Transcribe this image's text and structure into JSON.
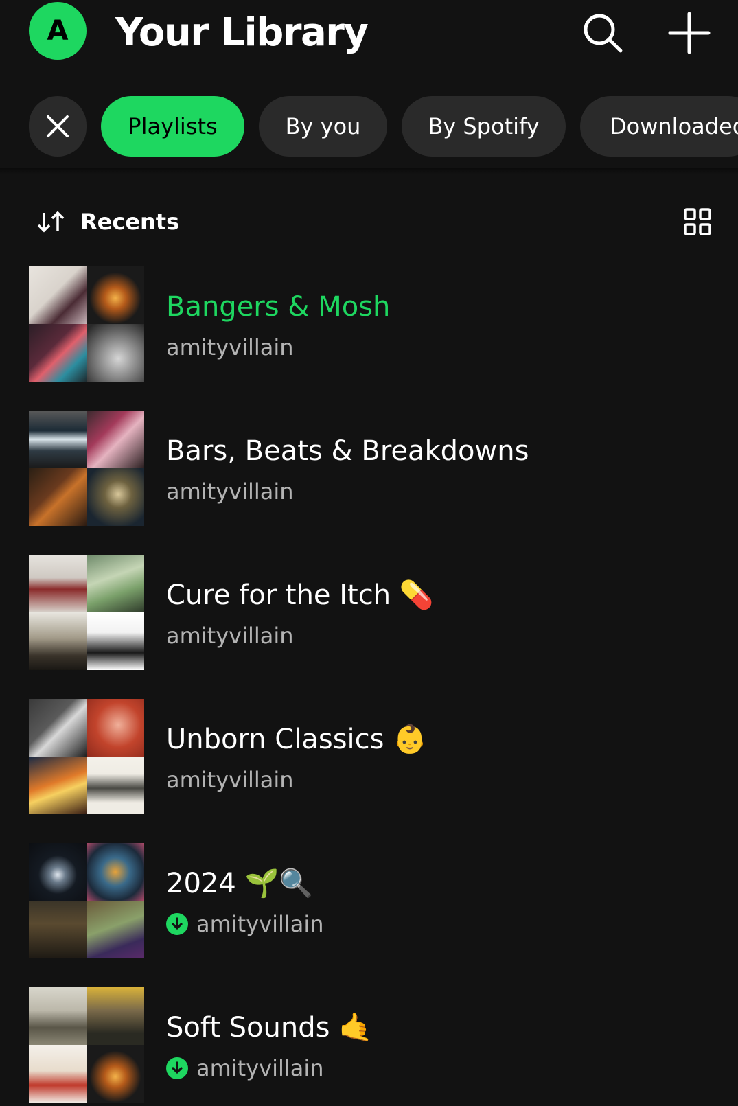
{
  "header": {
    "avatar_letter": "A",
    "title": "Your Library",
    "icons": [
      "search-icon",
      "plus-icon"
    ]
  },
  "filters": {
    "close_icon": "close-icon",
    "chips": [
      {
        "label": "Playlists",
        "active": true
      },
      {
        "label": "By you",
        "active": false
      },
      {
        "label": "By Spotify",
        "active": false
      },
      {
        "label": "Downloaded",
        "active": false
      }
    ]
  },
  "sort": {
    "label": "Recents",
    "sort_icon": "sort-arrows-icon",
    "view_icon": "grid-view-icon"
  },
  "colors": {
    "accent": "#1ed760",
    "background": "#121212",
    "chip": "#2a2a2a",
    "secondary_text": "#b3b3b3"
  },
  "playlists": [
    {
      "name": "Bangers & Mosh",
      "owner": "amityvillain",
      "active": true,
      "downloaded": false
    },
    {
      "name": "Bars, Beats & Breakdowns",
      "owner": "amityvillain",
      "active": false,
      "downloaded": false
    },
    {
      "name": "Cure for the Itch 💊",
      "owner": "amityvillain",
      "active": false,
      "downloaded": false
    },
    {
      "name": "Unborn Classics 👶",
      "owner": "amityvillain",
      "active": false,
      "downloaded": false
    },
    {
      "name": "2024 🌱🔍",
      "owner": "amityvillain",
      "active": false,
      "downloaded": true
    },
    {
      "name": "Soft Sounds 🤙",
      "owner": "amityvillain",
      "active": false,
      "downloaded": true
    }
  ]
}
